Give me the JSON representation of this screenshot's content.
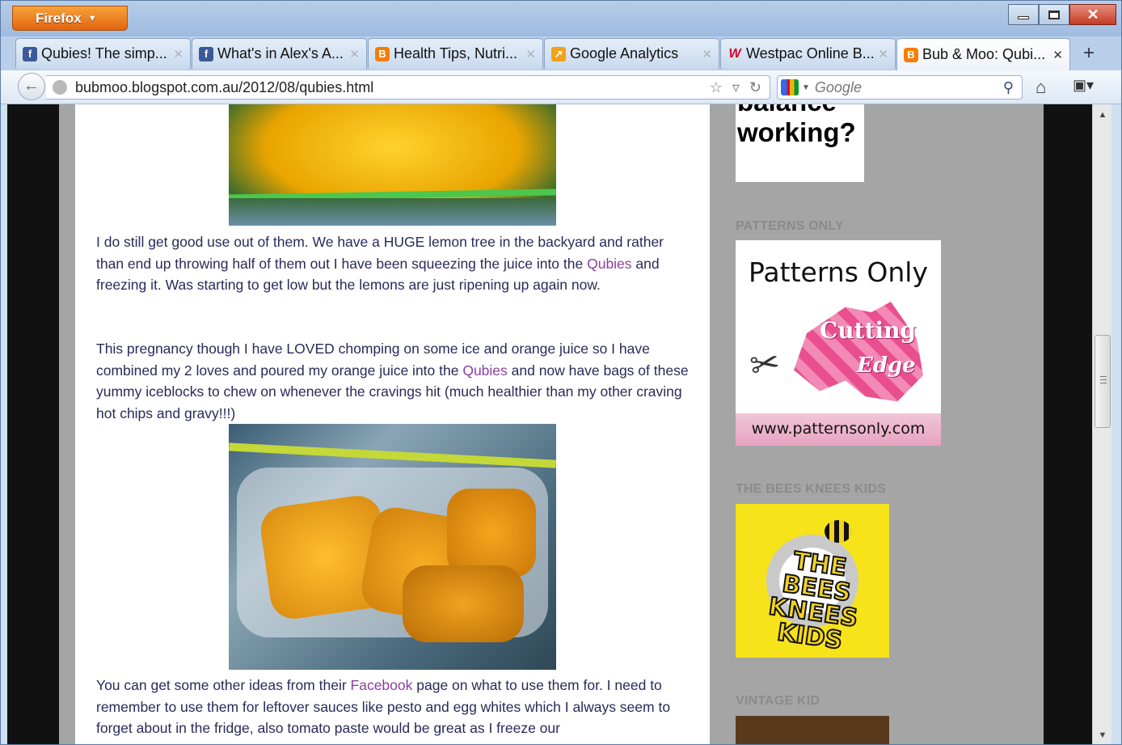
{
  "browser": {
    "app_button": "Firefox",
    "colors": {
      "accent": "#e2650f",
      "link": "#8d3ea2",
      "body_text": "#2a2a5a",
      "sidebar_bg": "#a5a5a5"
    }
  },
  "tabs": [
    {
      "label": "Qubies! The simp...",
      "favicon": "facebook-icon"
    },
    {
      "label": "What's in Alex's A...",
      "favicon": "facebook-icon"
    },
    {
      "label": "Health Tips, Nutri...",
      "favicon": "blogger-icon"
    },
    {
      "label": "Google Analytics",
      "favicon": "google-analytics-icon"
    },
    {
      "label": "Westpac Online B...",
      "favicon": "westpac-icon"
    },
    {
      "label": "Bub & Moo: Qubi...",
      "favicon": "blogger-icon",
      "active": true
    }
  ],
  "navbar": {
    "url": "bubmoo.blogspot.com.au/2012/08/qubies.html",
    "search_placeholder": "Google"
  },
  "post": {
    "p1_text": " I do still get good use out of them. We have a HUGE lemon tree in the backyard and rather than end up throwing half of them out I have been squeezing the juice into the ",
    "p1_link": "Qubies",
    "p1_tail": " and freezing it. Was starting to get low but the lemons are just ripening up again now.",
    "p2_text": "This pregnancy though I have LOVED chomping on some ice and orange juice so I have combined my 2 loves and poured my orange juice into the ",
    "p2_link": "Qubies",
    "p2_tail": " and now have bags of these yummy iceblocks to chew on whenever the cravings hit (much healthier than my other craving hot chips and gravy!!!)",
    "p3_text": "You can get some other ideas from their ",
    "p3_link": "Facebook",
    "p3_tail": " page on what to use them for. I need to remember to use them for leftover sauces like pesto and egg whites which I always seem to forget about in the fridge, also tomato paste would be great as I freeze our"
  },
  "sidebar": {
    "work_life_line1": "balance",
    "work_life_line2": "working?",
    "widget1_title": "PATTERNS ONLY",
    "patterns_only_title": "Patterns Only",
    "patterns_only_cut1": "Cutting",
    "patterns_only_cut2": "Edge",
    "patterns_only_url": "www.patternsonly.com",
    "widget2_title": "THE BEES KNEES KIDS",
    "bees_knees_text": "THE BEES KNEES KIDS",
    "widget3_title": "VINTAGE KID"
  }
}
